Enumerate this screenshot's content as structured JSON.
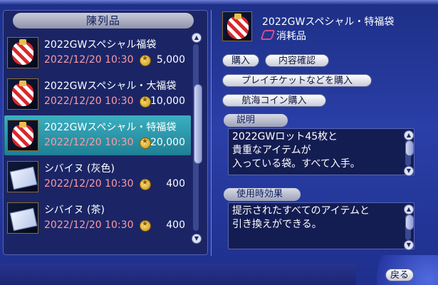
{
  "shop": {
    "header": "陳列品",
    "items": [
      {
        "name": "2022GWスペシャル福袋",
        "date": "2022/12/20 10:30",
        "price": "5,000",
        "icon": "lucky-bag-icon"
      },
      {
        "name": "2022GWスペシャル・大福袋",
        "date": "2022/12/20 10:30",
        "price": "10,000",
        "icon": "lucky-bag-icon"
      },
      {
        "name": "2022GWスペシャル・特福袋",
        "date": "2022/12/20 10:30",
        "price": "20,000",
        "icon": "lucky-bag-icon",
        "selected": true
      },
      {
        "name": "シバイヌ (灰色)",
        "date": "2022/12/20 10:30",
        "price": "400",
        "icon": "ticket-icon"
      },
      {
        "name": "シバイヌ (茶)",
        "date": "2022/12/20 10:30",
        "price": "400",
        "icon": "ticket-icon"
      }
    ]
  },
  "detail": {
    "title": "2022GWスペシャル・特福袋",
    "category": "消耗品",
    "buttons": {
      "buy": "購入",
      "inspect": "内容確認",
      "buy_ticket": "プレイチケットなどを購入",
      "buy_coin": "航海コイン購入"
    },
    "description_header": "説明",
    "description_lines": [
      "2022GWロット45枚と",
      "貴重なアイテムが",
      "入っている袋。すべて入手。"
    ],
    "effect_header": "使用時効果",
    "effect_lines": [
      "提示されたすべてのアイテムと",
      "引き換えができる。"
    ]
  },
  "back_label": "戻る",
  "colors": {
    "selected_row": "#2ba0b3",
    "date_text": "#ff9aa2",
    "panel_bg": "#1b2566"
  }
}
